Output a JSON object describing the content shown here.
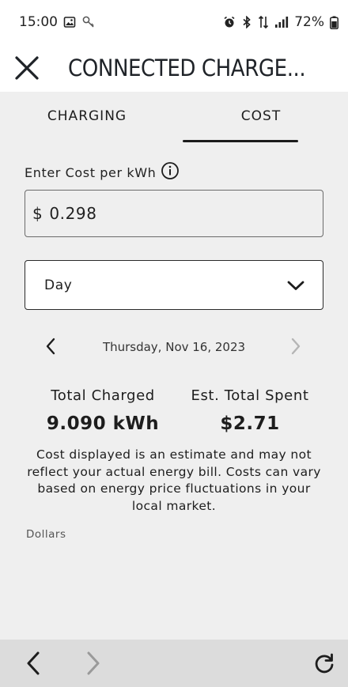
{
  "status_bar": {
    "time": "15:00",
    "battery": "72%",
    "left_icons": [
      "gallery-icon",
      "key-icon"
    ],
    "right_icons": [
      "alarm-icon",
      "bluetooth-icon",
      "data-transfer-icon",
      "signal-icon",
      "battery-icon"
    ]
  },
  "header": {
    "title": "CONNECTED CHARGE...",
    "close_icon": "close-icon"
  },
  "tabs": [
    {
      "label": "CHARGING",
      "selected": false
    },
    {
      "label": "COST",
      "selected": true
    }
  ],
  "cost_input": {
    "label": "Enter Cost per kWh",
    "currency": "$",
    "value": "0.298",
    "info_icon": "info-icon"
  },
  "period_select": {
    "selected": "Day",
    "icon": "chevron-down-icon"
  },
  "date_nav": {
    "date": "Thursday, Nov 16, 2023",
    "prev_icon": "chevron-left-icon",
    "next_icon": "chevron-right-icon",
    "next_enabled": false
  },
  "summary": {
    "total_charged_label": "Total Charged",
    "total_charged_value": "9.090 kWh",
    "est_spent_label": "Est. Total Spent",
    "est_spent_value": "$2.71"
  },
  "disclaimer": "Cost displayed is an estimate and may not reflect your actual energy bill. Costs can vary based on energy price fluctuations in your local market.",
  "chart": {
    "axis_label": "Dollars"
  },
  "browser_nav": {
    "back_icon": "back-arrow-icon",
    "forward_icon": "forward-arrow-icon",
    "forward_enabled": false,
    "reload_icon": "reload-icon"
  },
  "colors": {
    "background": "#efefef",
    "text": "#1d1d1d",
    "disabled": "#b5b5b5",
    "nav_bar": "#dcdcdc"
  }
}
